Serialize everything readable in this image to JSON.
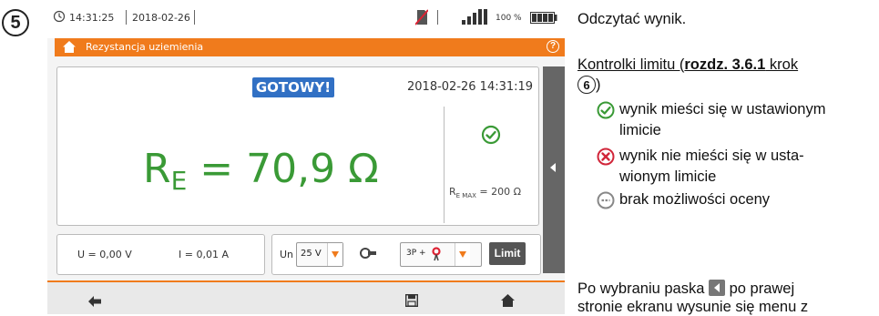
{
  "step_number": "5",
  "device": {
    "status": {
      "time": "14:31:25",
      "date": "2018-02-26",
      "battery_percent": "100 %"
    },
    "title": "Rezystancja uziemienia",
    "help_label": "?",
    "ready_label": "GOTOWY!",
    "datetime": "2018-02-26 14:31:19",
    "result": {
      "symbol": "R",
      "subscript": "E",
      "value_text": " = 70,9 Ω"
    },
    "limit": {
      "symbol": "R",
      "subscript": "E MAX",
      "value_text": " = 200 Ω"
    },
    "voltage": "U = 0,00 V",
    "current": "I = 0,01 A",
    "un_label": "Un",
    "un_value": "25 V",
    "mode_value": "3P +",
    "limit_button": "Limit",
    "colors": {
      "accent": "#f07b1c",
      "ok": "#3a9a36",
      "ready": "#3170c4"
    }
  },
  "doc": {
    "instruction": "Odczytać wynik.",
    "limit_heading_pre": "Kontrolki limitu (",
    "limit_heading_bold": "rozdz. 3.6.1",
    "limit_heading_post": " krok",
    "limit_heading_step": "6",
    "limit_heading_close": ")",
    "legend_ok_1": "wynik mieści się w ustawionym",
    "legend_ok_2": "limicie",
    "legend_fail_1": "wynik nie mieści się w usta-",
    "legend_fail_2": "wionym limicie",
    "legend_none": "brak możliwości oceny",
    "para_1a": "Po wybraniu paska",
    "para_1b": "po prawej",
    "para_2": "stronie ekranu wysunie się menu z"
  }
}
